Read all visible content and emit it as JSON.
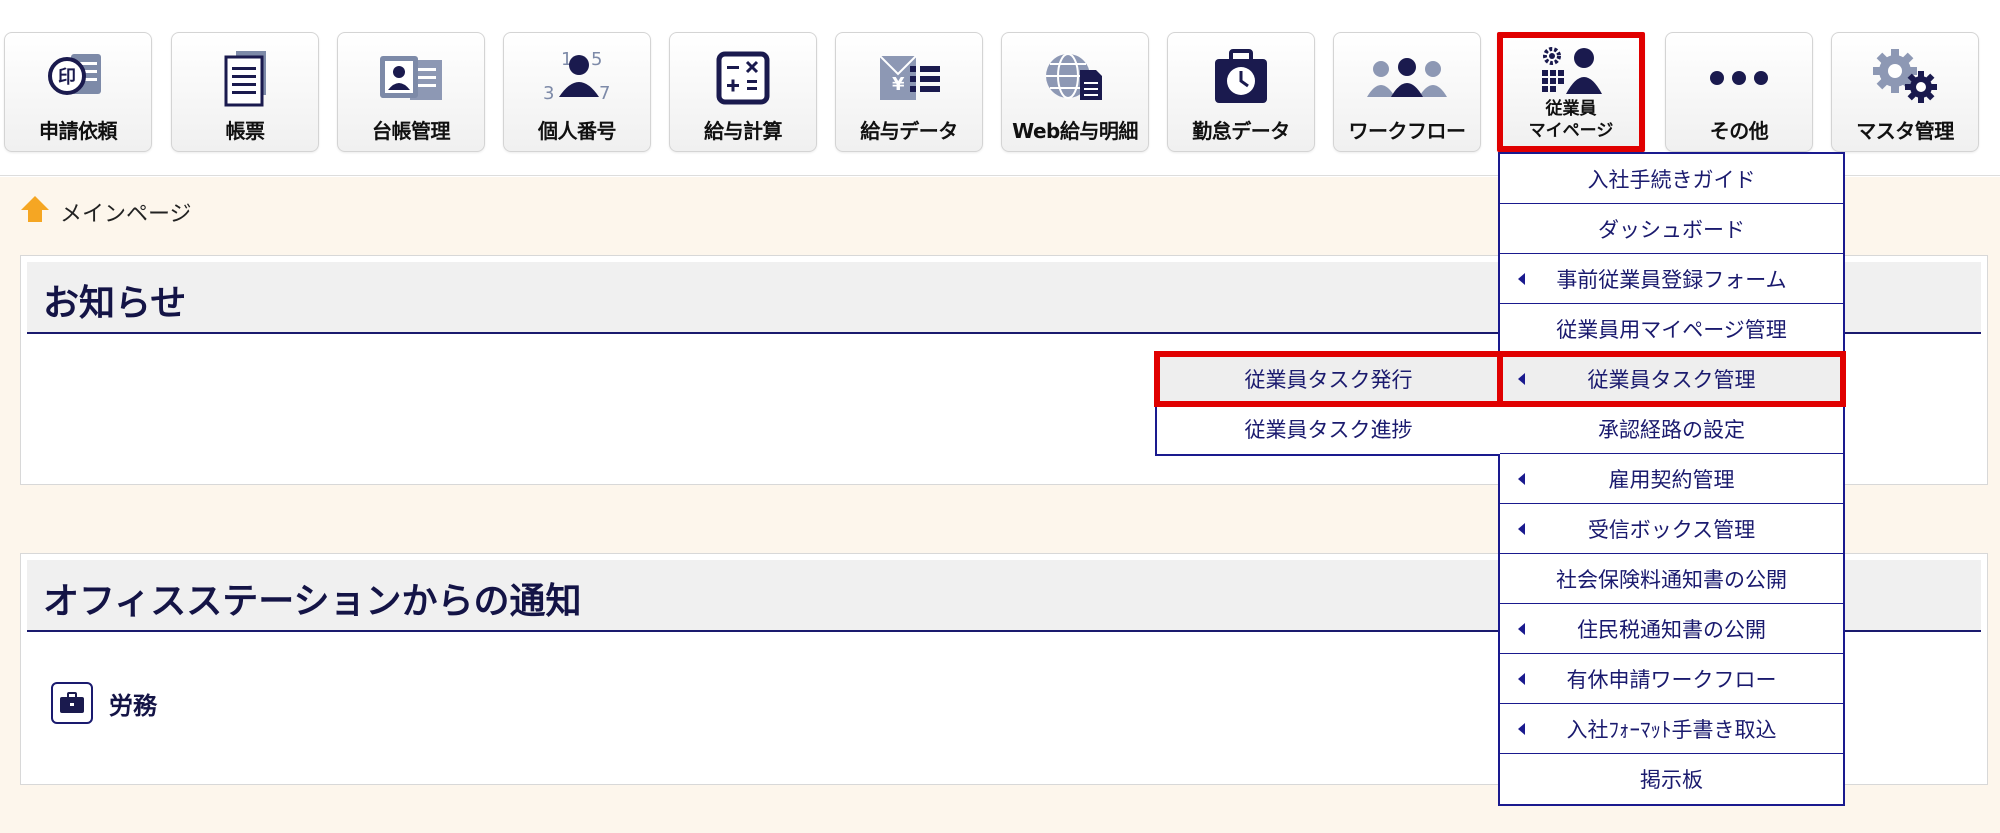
{
  "toolbar": {
    "buttons": [
      {
        "label": "申請依頼",
        "icon": "stamp-icon"
      },
      {
        "label": "帳票",
        "icon": "document-icon"
      },
      {
        "label": "台帳管理",
        "icon": "ledger-icon"
      },
      {
        "label": "個人番号",
        "icon": "personal-number-icon"
      },
      {
        "label": "給与計算",
        "icon": "calculator-icon"
      },
      {
        "label": "給与データ",
        "icon": "salary-data-icon"
      },
      {
        "label": "Web給与明細",
        "icon": "web-payslip-icon"
      },
      {
        "label": "勤怠データ",
        "icon": "attendance-icon"
      },
      {
        "label": "ワークフロー",
        "icon": "workflow-icon"
      },
      {
        "label": "従業員",
        "label2": "マイページ",
        "icon": "employee-mypage-icon"
      },
      {
        "label": "その他",
        "icon": "more-icon"
      },
      {
        "label": "マスタ管理",
        "icon": "master-settings-icon"
      }
    ]
  },
  "breadcrumb": {
    "label": "メインページ",
    "icon": "home-icon"
  },
  "notices": {
    "title": "お知らせ"
  },
  "office_station": {
    "title": "オフィスステーションからの通知",
    "category": "労務",
    "category_icon": "briefcase-icon"
  },
  "menu": {
    "items": [
      {
        "label": "入社手続きガイド",
        "has_sub": false
      },
      {
        "label": "ダッシュボード",
        "has_sub": false
      },
      {
        "label": "事前従業員登録フォーム",
        "has_sub": true
      },
      {
        "label": "従業員用マイページ管理",
        "has_sub": false
      },
      {
        "label": "従業員タスク管理",
        "has_sub": true
      },
      {
        "label": "承認経路の設定",
        "has_sub": false
      },
      {
        "label": "雇用契約管理",
        "has_sub": true
      },
      {
        "label": "受信ボックス管理",
        "has_sub": true
      },
      {
        "label": "社会保険料通知書の公開",
        "has_sub": false
      },
      {
        "label": "住民税通知書の公開",
        "has_sub": true
      },
      {
        "label": "有休申請ワークフロー",
        "has_sub": true
      },
      {
        "label": "入社ﾌｫｰﾏｯﾄ手書き取込",
        "has_sub": true
      },
      {
        "label": "掲示板",
        "has_sub": false
      }
    ]
  },
  "submenu": {
    "items": [
      {
        "label": "従業員タスク発行"
      },
      {
        "label": "従業員タスク進捗"
      }
    ]
  },
  "colors": {
    "accent_red": "#e00000",
    "navy": "#1a1a6e",
    "background": "#fdf6ec"
  }
}
